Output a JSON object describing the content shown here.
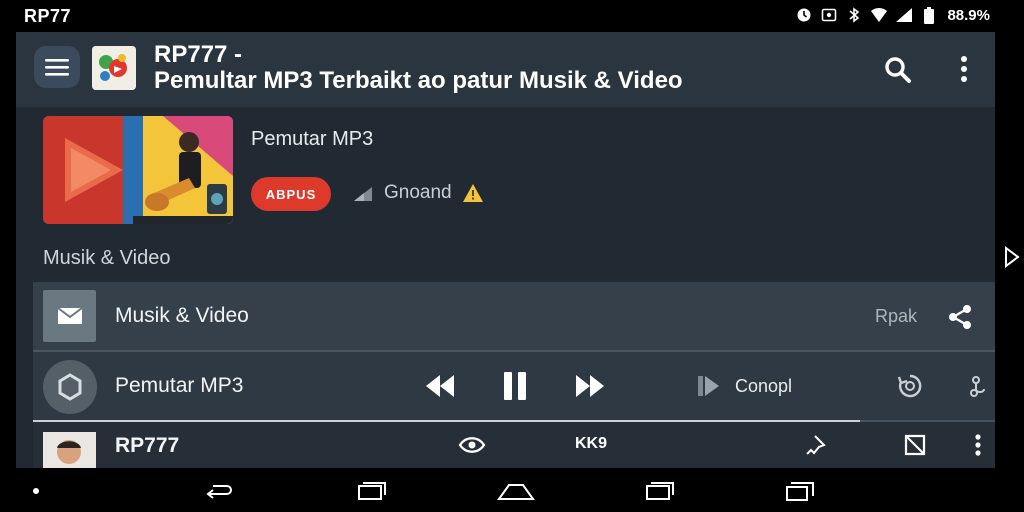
{
  "status_bar": {
    "carrier": "RP77",
    "battery_text": "88.9%"
  },
  "app_bar": {
    "title_line1": "RP777 -",
    "title_line2": "Pemultar MP3 Terbaikt ao patur Musik & Video"
  },
  "hero": {
    "title": "Pemutar MP3",
    "badge": "ABPUS",
    "meta_text": "Gnoand"
  },
  "section": {
    "header": "Musik & Video"
  },
  "rows": [
    {
      "label": "Musik & Video",
      "trailing": "Rpak"
    },
    {
      "label": "Pemutar MP3",
      "trailing": "Conopl"
    },
    {
      "label": "RP777",
      "center_text": "KK9"
    }
  ],
  "player": {
    "progress": 0.86
  },
  "colors": {
    "app_bar": "#2a3540",
    "window": "#212a33",
    "badge": "#dd3a2c",
    "row_active": "#36404a"
  },
  "icons": {
    "menu": "hamburger-icon",
    "search": "search-icon",
    "more": "more-vert-icon",
    "share": "share-icon",
    "rewind": "rewind-icon",
    "pause": "pause-icon",
    "fast_forward": "fast-forward-icon",
    "next": "skip-next-icon",
    "replay": "replay-icon",
    "eye": "eye-icon",
    "crop": "crop-icon"
  }
}
